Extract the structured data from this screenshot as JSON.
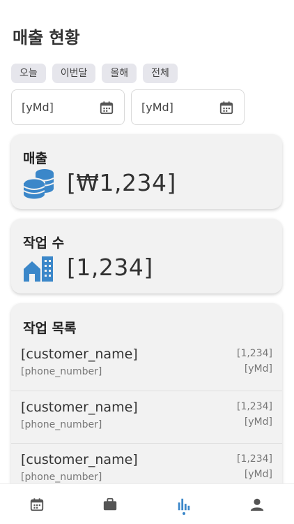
{
  "page": {
    "title": "매출 현황"
  },
  "filters": {
    "chips": [
      {
        "label": "오늘"
      },
      {
        "label": "이번달"
      },
      {
        "label": "올해"
      },
      {
        "label": "전체"
      }
    ],
    "start_date": {
      "value": "[yMd]",
      "icon": "calendar-icon"
    },
    "end_date": {
      "value": "[yMd]",
      "icon": "calendar-icon"
    }
  },
  "sales": {
    "label": "매출",
    "value": "[₩1,234]",
    "icon": "coin-stack-icon"
  },
  "jobs": {
    "label": "작업 수",
    "value": "[1,234]",
    "icon": "building-icon"
  },
  "job_list": {
    "title": "작업 목록",
    "items": [
      {
        "name": "[customer_name]",
        "phone": "[phone_number]",
        "count": "[1,234]",
        "date": "[yMd]"
      },
      {
        "name": "[customer_name]",
        "phone": "[phone_number]",
        "count": "[1,234]",
        "date": "[yMd]"
      },
      {
        "name": "[customer_name]",
        "phone": "[phone_number]",
        "count": "[1,234]",
        "date": "[yMd]"
      }
    ]
  },
  "bottom_nav": {
    "items": [
      {
        "icon": "calendar-icon",
        "active": false
      },
      {
        "icon": "briefcase-icon",
        "active": false
      },
      {
        "icon": "bar-chart-icon",
        "active": true
      },
      {
        "icon": "person-icon",
        "active": false
      }
    ]
  },
  "colors": {
    "accent": "#3b87c9",
    "card_bg": "#f2f2f2",
    "chip_bg": "#e6e6ec"
  }
}
